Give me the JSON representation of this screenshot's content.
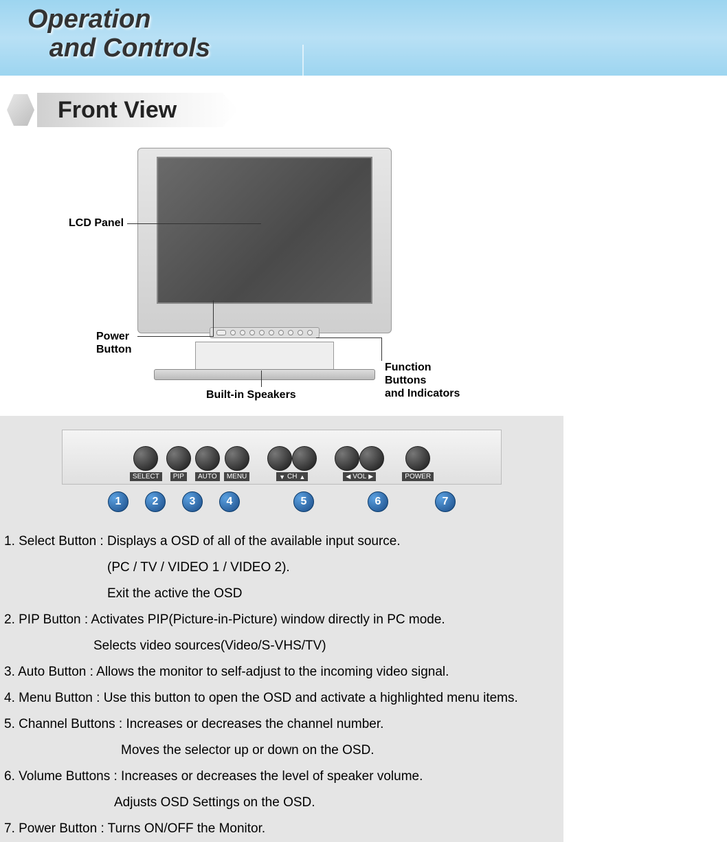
{
  "header": {
    "title_line1": "Operation",
    "title_line2": "and Controls"
  },
  "section": {
    "title": "Front View"
  },
  "diagram": {
    "lcd_panel_label": "LCD Panel",
    "power_button_label_line1": "Power",
    "power_button_label_line2": "Button",
    "speakers_label": "Built-in Speakers",
    "function_label_line1": "Function",
    "function_label_line2": "Buttons",
    "function_label_line3": "and Indicators"
  },
  "panel": {
    "buttons": [
      {
        "label": "SELECT",
        "num": "1"
      },
      {
        "label": "PIP",
        "num": "2"
      },
      {
        "label": "AUTO",
        "num": "3"
      },
      {
        "label": "MENU",
        "num": "4"
      }
    ],
    "channel": {
      "num": "5",
      "label_prefix": "▼",
      "label_text": "CH",
      "label_suffix": "▲"
    },
    "volume": {
      "num": "6",
      "label_prefix": "◀",
      "label_text": "VOL",
      "label_suffix": "▶"
    },
    "power": {
      "label": "POWER",
      "num": "7"
    }
  },
  "descriptions": {
    "d1a": "1. Select Button : Displays a OSD of all of the available input source.",
    "d1b": "(PC / TV / VIDEO 1 / VIDEO 2).",
    "d1c": "Exit the active the OSD",
    "d2a": "2. PIP Button : Activates PIP(Picture-in-Picture) window directly in PC mode.",
    "d2b": "Selects video sources(Video/S-VHS/TV)",
    "d3": "3. Auto Button : Allows the monitor to self-adjust to the incoming video signal.",
    "d4": "4. Menu Button : Use this button to open the OSD and activate a highlighted menu items.",
    "d5a": "5. Channel Buttons : Increases or decreases the channel number.",
    "d5b": "Moves the selector up or down on the OSD.",
    "d6a": "6. Volume Buttons : Increases or decreases the level of speaker volume.",
    "d6b": "Adjusts OSD Settings on the OSD.",
    "d7": "7. Power Button : Turns ON/OFF the Monitor."
  }
}
